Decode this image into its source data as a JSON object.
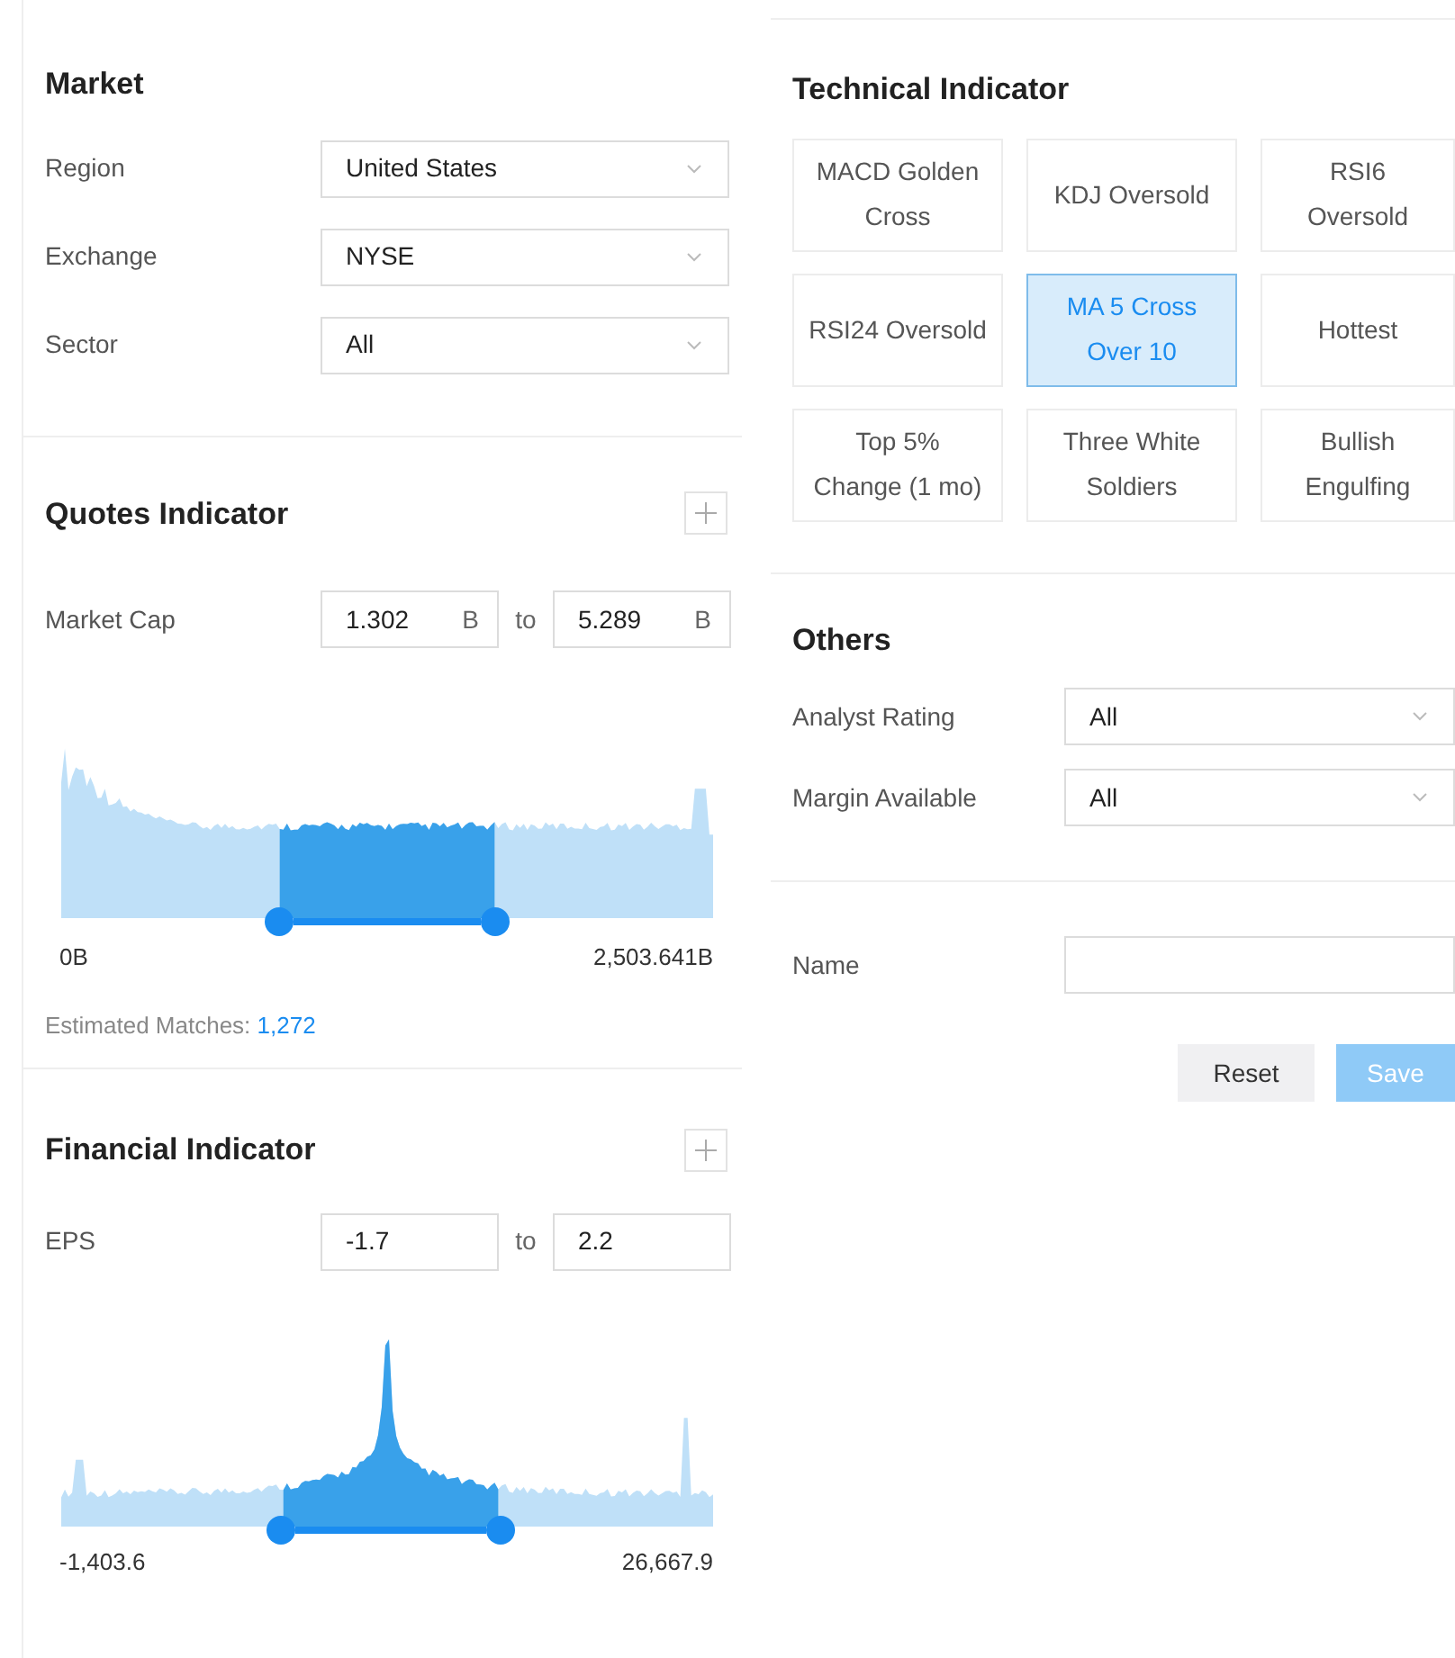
{
  "market": {
    "title": "Market",
    "fields": [
      {
        "label": "Region",
        "value": "United States"
      },
      {
        "label": "Exchange",
        "value": "NYSE"
      },
      {
        "label": "Sector",
        "value": "All"
      }
    ]
  },
  "quotes_indicator": {
    "title": "Quotes Indicator",
    "label": "Market Cap",
    "from": "1.302",
    "from_unit": "B",
    "separator": "to",
    "to": "5.289",
    "to_unit": "B",
    "handles": [
      {
        "level": 0.334
      },
      {
        "level": 0.666
      }
    ],
    "min_label": "0B",
    "max_label": "2,503.641B",
    "matches_label": "Estimated Matches:",
    "matches_value": "1,272"
  },
  "financial_indicator": {
    "title": "Financial Indicator",
    "label": "EPS",
    "from": "-1.7",
    "separator": "to",
    "to": "2.2",
    "handles": [
      {
        "level": 0.337
      },
      {
        "level": 0.674
      }
    ],
    "min_label": "-1,403.6",
    "max_label": "26,667.9"
  },
  "technical_indicator": {
    "title": "Technical Indicator",
    "items": [
      {
        "label": "MACD Golden Cross",
        "selected": false
      },
      {
        "label": "KDJ Oversold",
        "selected": false
      },
      {
        "label": "RSI6 Oversold",
        "selected": false
      },
      {
        "label": "RSI24 Oversold",
        "selected": false
      },
      {
        "label": "MA 5 Cross Over 10",
        "selected": true
      },
      {
        "label": "Hottest",
        "selected": false
      },
      {
        "label": "Top 5% Change (1 mo)",
        "selected": false
      },
      {
        "label": "Three White Soldiers",
        "selected": false
      },
      {
        "label": "Bullish Engulfing",
        "selected": false
      }
    ]
  },
  "others": {
    "title": "Others",
    "fields": [
      {
        "label": "Analyst Rating",
        "value": "All"
      },
      {
        "label": "Margin Available",
        "value": "All"
      }
    ]
  },
  "name_field": {
    "label": "Name"
  },
  "buttons": [
    {
      "label": "Reset",
      "kind": "secondary"
    },
    {
      "label": "Save",
      "kind": "primary"
    }
  ]
}
